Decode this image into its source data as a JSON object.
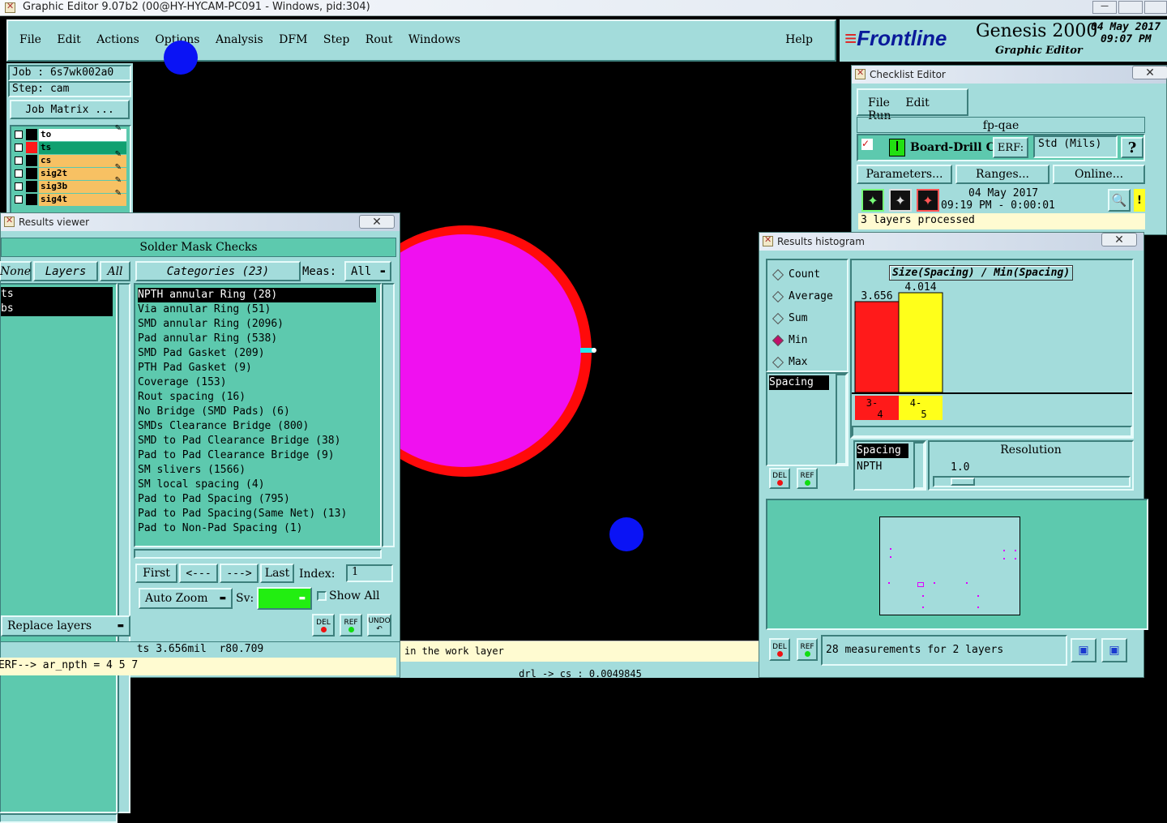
{
  "os_title": "Graphic Editor 9.07b2 (00@HY-HYCAM-PC091 - Windows, pid:304)",
  "menu": {
    "file": "File",
    "edit": "Edit",
    "actions": "Actions",
    "options": "Options",
    "analysis": "Analysis",
    "dfm": "DFM",
    "step": "Step",
    "rout": "Rout",
    "windows": "Windows",
    "help": "Help"
  },
  "brand": {
    "logo": "Frontline",
    "product": "Genesis 2000",
    "subtitle": "Graphic Editor",
    "date": "04 May 2017",
    "time": "09:07 PM"
  },
  "job": {
    "job_label": "Job : 6s7wk002a0",
    "step_label": "Step: cam",
    "matrix_button": "Job Matrix ..."
  },
  "layers": [
    {
      "name": "to",
      "color": "#000000",
      "bg": "#ffffff",
      "pen": "✎"
    },
    {
      "name": "ts",
      "color": "#ff1a1a",
      "bg": "#10a070",
      "pen": ""
    },
    {
      "name": "cs",
      "color": "#000000",
      "bg": "#f7c163",
      "pen": "✎"
    },
    {
      "name": "sig2t",
      "color": "#000000",
      "bg": "#f7c163",
      "pen": "✎"
    },
    {
      "name": "sig3b",
      "color": "#000000",
      "bg": "#f7c163",
      "pen": "✎"
    },
    {
      "name": "sig4t",
      "color": "#000000",
      "bg": "#f7c163",
      "pen": "✎"
    }
  ],
  "results_viewer": {
    "title": "Results viewer",
    "heading": "Solder Mask Checks",
    "none_btn": "None",
    "layers_btn": "Layers",
    "all_btn": "All",
    "layer_list": [
      "ts",
      "bs"
    ],
    "categories_btn": "Categories (23)",
    "meas_label": "Meas:",
    "meas_value": "All",
    "categories": [
      "NPTH annular Ring (28)",
      "Via annular Ring (51)",
      "SMD annular Ring (2096)",
      "Pad annular Ring (538)",
      "SMD Pad Gasket (209)",
      "PTH Pad Gasket (9)",
      "Coverage (153)",
      "Rout spacing (16)",
      "No Bridge (SMD Pads) (6)",
      "SMDs Clearance Bridge (800)",
      "SMD to Pad Clearance Bridge (38)",
      "Pad to Pad Clearance Bridge (9)",
      "SM slivers (1566)",
      "SM local spacing (4)",
      "Pad to Pad Spacing (795)",
      "Pad to Pad Spacing(Same Net) (13)",
      "Pad to Non-Pad Spacing (1)"
    ],
    "first_btn": "First",
    "prev_btn": "<---",
    "next_btn": "--->",
    "last_btn": "Last",
    "index_label": "Index:",
    "index_value": "1",
    "zoom_value": "Auto Zoom",
    "sv_label": "Sv:",
    "show_all": "Show All",
    "replace_layers": "Replace layers",
    "del": "DEL",
    "ref": "REF",
    "undo": "UNDO"
  },
  "status": {
    "measure": "ts 3.656mil  r80.709",
    "command": "ERF--> ar_npth = 4 5 7",
    "message": "in the work layer",
    "bottom": "drl -> cs : 0.0049845"
  },
  "checklist": {
    "title": "Checklist Editor",
    "menu_file": "File",
    "menu_edit": "Edit",
    "menu_run": "Run",
    "name": "fp-qae",
    "action": "Board-Drill Che",
    "erf": "ERF:",
    "erf_value": "Std (Mils)",
    "help": "?",
    "parameters": "Parameters...",
    "ranges": "Ranges...",
    "online": "Online...",
    "date": "04 May 2017",
    "time": "09:19 PM - 0:00:01",
    "processed": "3 layers processed",
    "warn": "!"
  },
  "histogram": {
    "title": "Results histogram",
    "modes": [
      "Count",
      "Average",
      "Sum",
      "Min",
      "Max"
    ],
    "selected_mode": "Min",
    "measure_item": "Spacing",
    "chart_title": "Size(Spacing) / Min(Spacing)",
    "resolution_label": "Resolution",
    "resolution_value": "1.0",
    "list_items": [
      "Spacing",
      "NPTH"
    ],
    "measurements": "28 measurements for 2 layers",
    "del": "DEL",
    "ref": "REF"
  },
  "chart_data": {
    "type": "bar",
    "title": "Size(Spacing) / Min(Spacing)",
    "categories": [
      "3-4",
      "4-5"
    ],
    "category_lines": [
      [
        "3-",
        "4"
      ],
      [
        "4-",
        "5"
      ]
    ],
    "values": [
      3.656,
      4.014
    ],
    "value_labels": [
      "3.656",
      "4.014"
    ],
    "colors": [
      "#ff1a1a",
      "#ffff1a"
    ],
    "ylim": [
      0,
      4.014
    ]
  }
}
